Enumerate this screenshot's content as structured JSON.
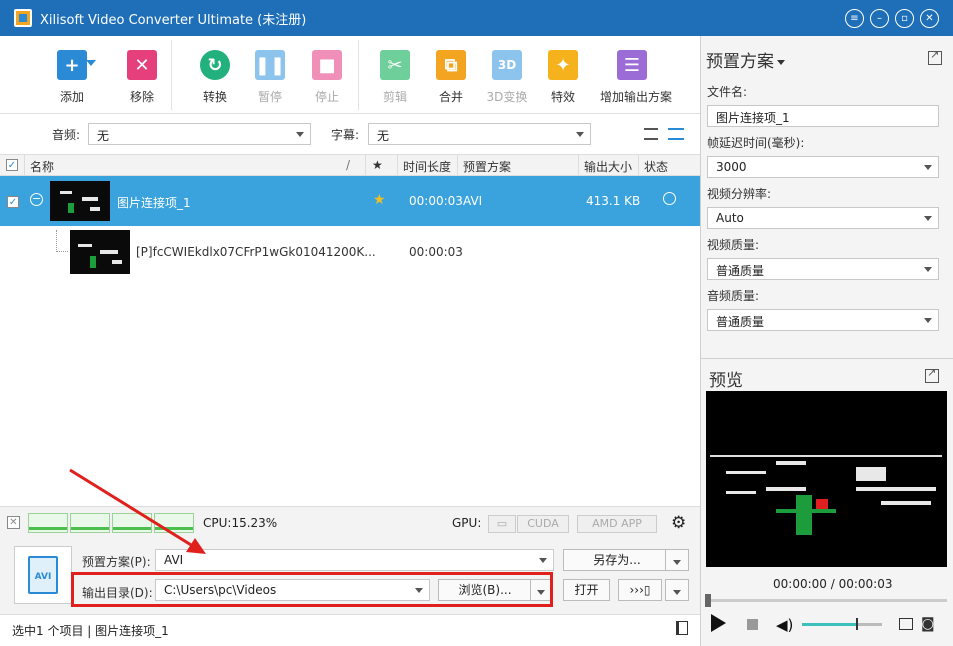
{
  "window": {
    "title": "Xilisoft Video Converter Ultimate (未注册)"
  },
  "toolbar": {
    "add": "添加",
    "remove": "移除",
    "convert": "转换",
    "pause": "暂停",
    "stop": "停止",
    "clip": "剪辑",
    "merge": "合并",
    "convert3d": "3D变换",
    "effects": "特效",
    "add_profile": "增加输出方案"
  },
  "filters": {
    "audio_label": "音频:",
    "audio_value": "无",
    "subtitle_label": "字幕:",
    "subtitle_value": "无"
  },
  "list_header": {
    "name": "名称",
    "star": "★",
    "duration": "时间长度",
    "profile": "预置方案",
    "size": "输出大小",
    "status": "状态"
  },
  "rows": [
    {
      "name": "图片连接项_1",
      "duration": "00:00:03",
      "profile": "AVI",
      "size": "413.1 KB"
    },
    {
      "name": "[P]fcCWIEkdlx07CFrP1wGk01041200K...",
      "duration": "00:00:03"
    }
  ],
  "cpu": {
    "label": "CPU:15.23%",
    "gpu_label": "GPU:",
    "cuda": "CUDA",
    "amd": "AMD APP"
  },
  "output": {
    "profile_label": "预置方案(P):",
    "profile_value": "AVI",
    "save_as": "另存为...",
    "dir_label": "输出目录(D):",
    "dir_value": "C:\\Users\\pc\\Videos",
    "browse": "浏览(B)...",
    "open": "打开",
    "fmt": "AVI"
  },
  "status": {
    "text": "选中1 个项目 | 图片连接项_1"
  },
  "right_panel": {
    "title": "预置方案",
    "filename_label": "文件名:",
    "filename_value": "图片连接项_1",
    "delay_label": "帧延迟时间(毫秒):",
    "delay_value": "3000",
    "resolution_label": "视频分辨率:",
    "resolution_value": "Auto",
    "vquality_label": "视频质量:",
    "vquality_value": "普通质量",
    "aquality_label": "音频质量:",
    "aquality_value": "普通质量",
    "preview_title": "预览",
    "time": "00:00:00 / 00:00:03"
  },
  "colors": {
    "titlebar": "#1e6fb8",
    "selected_row": "#3aa3dd",
    "highlight_red": "#e0201c"
  }
}
